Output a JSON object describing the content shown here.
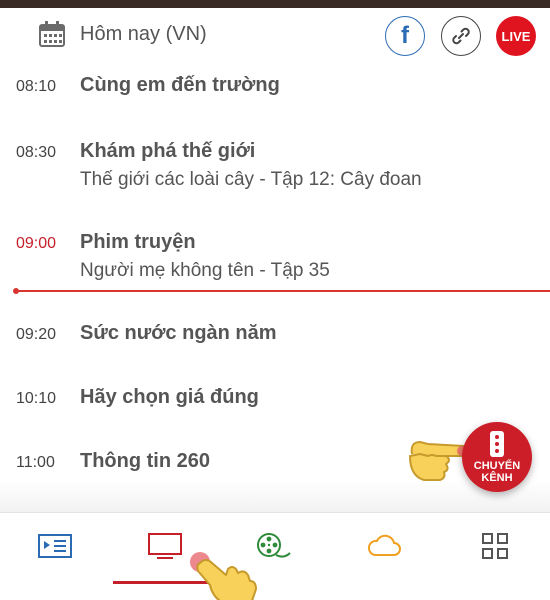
{
  "header": {
    "date_label": "Hôm nay (VN)",
    "facebook_label": "f",
    "live_label": "LIVE"
  },
  "schedule": [
    {
      "time": "08:10",
      "title": "Cùng em đến trường",
      "subtitle": ""
    },
    {
      "time": "08:30",
      "title": "Khám phá thế giới",
      "subtitle": "Thế giới các loài cây - Tập 12: Cây đoan"
    },
    {
      "time": "09:00",
      "title": "Phim truyện",
      "subtitle": "Người mẹ không tên - Tập 35",
      "current": true
    },
    {
      "time": "09:20",
      "title": "Sức nước ngàn năm",
      "subtitle": ""
    },
    {
      "time": "10:10",
      "title": "Hãy chọn giá đúng",
      "subtitle": ""
    },
    {
      "time": "11:00",
      "title": "Thông tin 260",
      "subtitle": ""
    }
  ],
  "fab": {
    "line1": "CHUYỂN",
    "line2": "KÊNH"
  },
  "bottom_nav": {
    "items": [
      {
        "icon": "program-guide-icon",
        "color": "#2b6bb3"
      },
      {
        "icon": "tv-icon",
        "color": "#c51f2a",
        "active": true
      },
      {
        "icon": "film-reel-icon",
        "color": "#2e8b3a"
      },
      {
        "icon": "cloud-icon",
        "color": "#f0a020"
      },
      {
        "icon": "grid-icon",
        "color": "#555555"
      }
    ]
  },
  "colors": {
    "accent_red": "#c51f2a",
    "live_red": "#e0141e",
    "facebook_blue": "#2b6bb3",
    "text_gray": "#555555"
  }
}
